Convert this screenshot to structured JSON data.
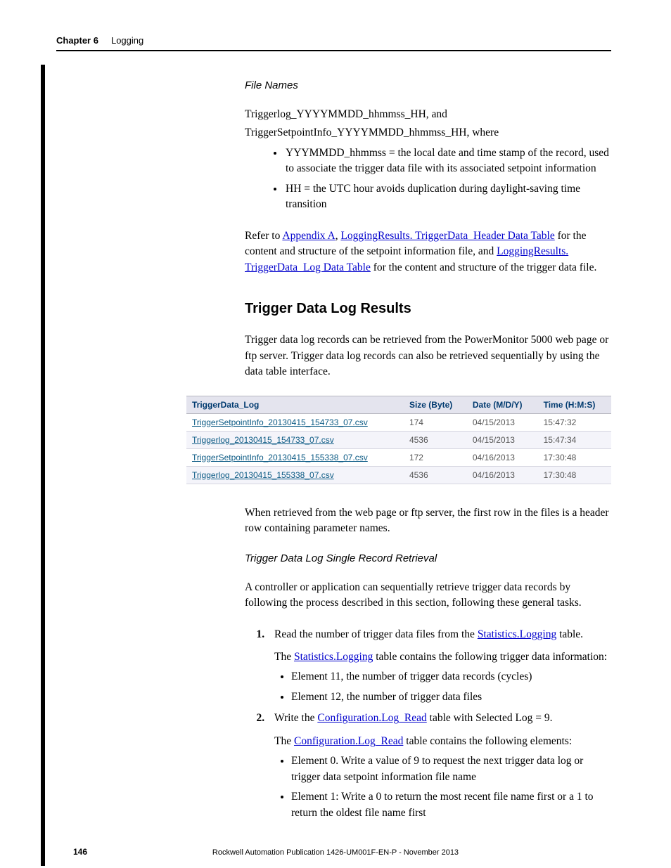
{
  "header": {
    "chapter": "Chapter 6",
    "title": "Logging"
  },
  "fileNames": {
    "heading": "File Names",
    "pattern1": "Triggerlog_YYYYMMDD_hhmmss_HH, and",
    "pattern2": "TriggerSetpointInfo_YYYYMMDD_hhmmss_HH, where",
    "bullets": [
      "YYYMMDD_hhmmss = the local date and time stamp of the record, used to associate the trigger data file with its associated setpoint information",
      "HH = the UTC hour avoids duplication during daylight-saving time transition"
    ],
    "refer_pre": "Refer to ",
    "appendixA": "Appendix A",
    "refer_mid1": ", ",
    "link_header": "LoggingResults. TriggerData_Header Data Table",
    "refer_mid2": " for the content and structure of the setpoint information file, and ",
    "link_log": "LoggingResults. TriggerData_Log Data Table",
    "refer_post": " for the content and structure of the trigger data file."
  },
  "results": {
    "heading": "Trigger Data Log Results",
    "intro": "Trigger data log records can be retrieved from the PowerMonitor 5000 web page or ftp server. Trigger data log records can also be retrieved sequentially by using the data table interface."
  },
  "table": {
    "headers": {
      "c1": "TriggerData_Log",
      "c2": "Size (Byte)",
      "c3": "Date (M/D/Y)",
      "c4": "Time (H:M:S)"
    },
    "rows": [
      {
        "name": "TriggerSetpointInfo_20130415_154733_07.csv",
        "size": "174",
        "date": "04/15/2013",
        "time": "15:47:32"
      },
      {
        "name": "Triggerlog_20130415_154733_07.csv",
        "size": "4536",
        "date": "04/15/2013",
        "time": "15:47:34"
      },
      {
        "name": "TriggerSetpointInfo_20130415_155338_07.csv",
        "size": "172",
        "date": "04/16/2013",
        "time": "17:30:48"
      },
      {
        "name": "Triggerlog_20130415_155338_07.csv",
        "size": "4536",
        "date": "04/16/2013",
        "time": "17:30:48"
      }
    ]
  },
  "afterTable": "When retrieved from the web page or ftp server, the first row in the files is a header row containing parameter names.",
  "single": {
    "heading": "Trigger Data Log Single Record Retrieval",
    "intro": "A controller or application can sequentially retrieve trigger data records by following the process described in this section, following these general tasks.",
    "step1_pre": "Read the number of trigger data files from the ",
    "step1_link": "Statistics.Logging",
    "step1_post": " table.",
    "step1_sub_pre": "The ",
    "step1_sub_link": "Statistics.Logging",
    "step1_sub_post": " table contains the following trigger data information:",
    "step1_bullets": [
      "Element 11, the number of trigger data records (cycles)",
      "Element 12, the number of trigger data files"
    ],
    "step2_pre": "Write the ",
    "step2_link": "Configuration.Log_Read",
    "step2_post": " table with Selected Log = 9.",
    "step2_sub_pre": "The ",
    "step2_sub_link": "Configuration.Log_Read",
    "step2_sub_post": " table contains the following elements:",
    "step2_bullets": [
      "Element 0. Write a value of 9 to request the next trigger data log or trigger data setpoint information file name",
      "Element 1: Write a 0 to return the most recent file name first or a 1 to return the oldest file name first"
    ]
  },
  "footer": {
    "page": "146",
    "pub": "Rockwell Automation Publication 1426-UM001F-EN-P - November 2013"
  }
}
